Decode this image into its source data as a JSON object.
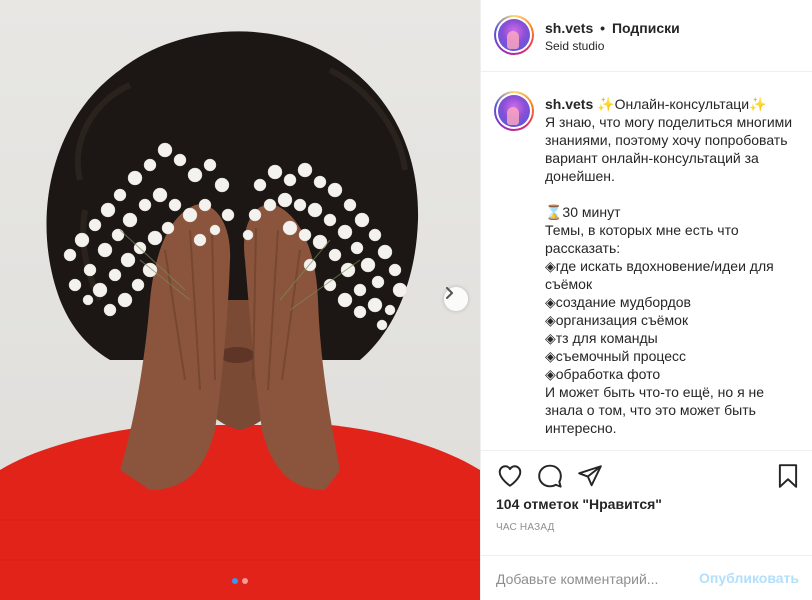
{
  "post": {
    "image_alt": "Woman with curly hair covering her face with hands holding white baby's breath flowers, red sweater",
    "carousel": {
      "total": 2,
      "active": 1
    }
  },
  "header": {
    "username": "sh.vets",
    "separator": "•",
    "follow_label": "Подписки",
    "location": "Seid studio"
  },
  "caption": {
    "author": "sh.vets",
    "text": " ✨Онлайн-консультаци✨\nЯ знаю, что могу поделиться многими знаниями, поэтому хочу попробовать вариант онлайн-консультаций за донейшен.\n\n⌛30 минут\nТемы, в которых мне есть что рассказать:\n◈где искать вдохновение/идеи для съёмок\n◈создание мудбордов\n◈организация съёмок\n◈тз для команды\n◈съемочный процесс\n◈обработка фото\nИ может быть что-то ещё, но я не знала о том, что это может быть интересно."
  },
  "actions": {
    "icons": [
      "heart-icon",
      "comment-icon",
      "share-icon",
      "bookmark-icon"
    ],
    "likes_text": "104 отметок \"Нравится\"",
    "time_text": "ЧАС НАЗАД"
  },
  "comment": {
    "placeholder": "Добавьте комментарий...",
    "publish_label": "Опубликовать"
  },
  "colors": {
    "accent": "#3897f0",
    "publish_disabled": "#b2dffc",
    "sweater": "#e2231a",
    "text": "#262626",
    "muted": "#8e8e8e"
  }
}
